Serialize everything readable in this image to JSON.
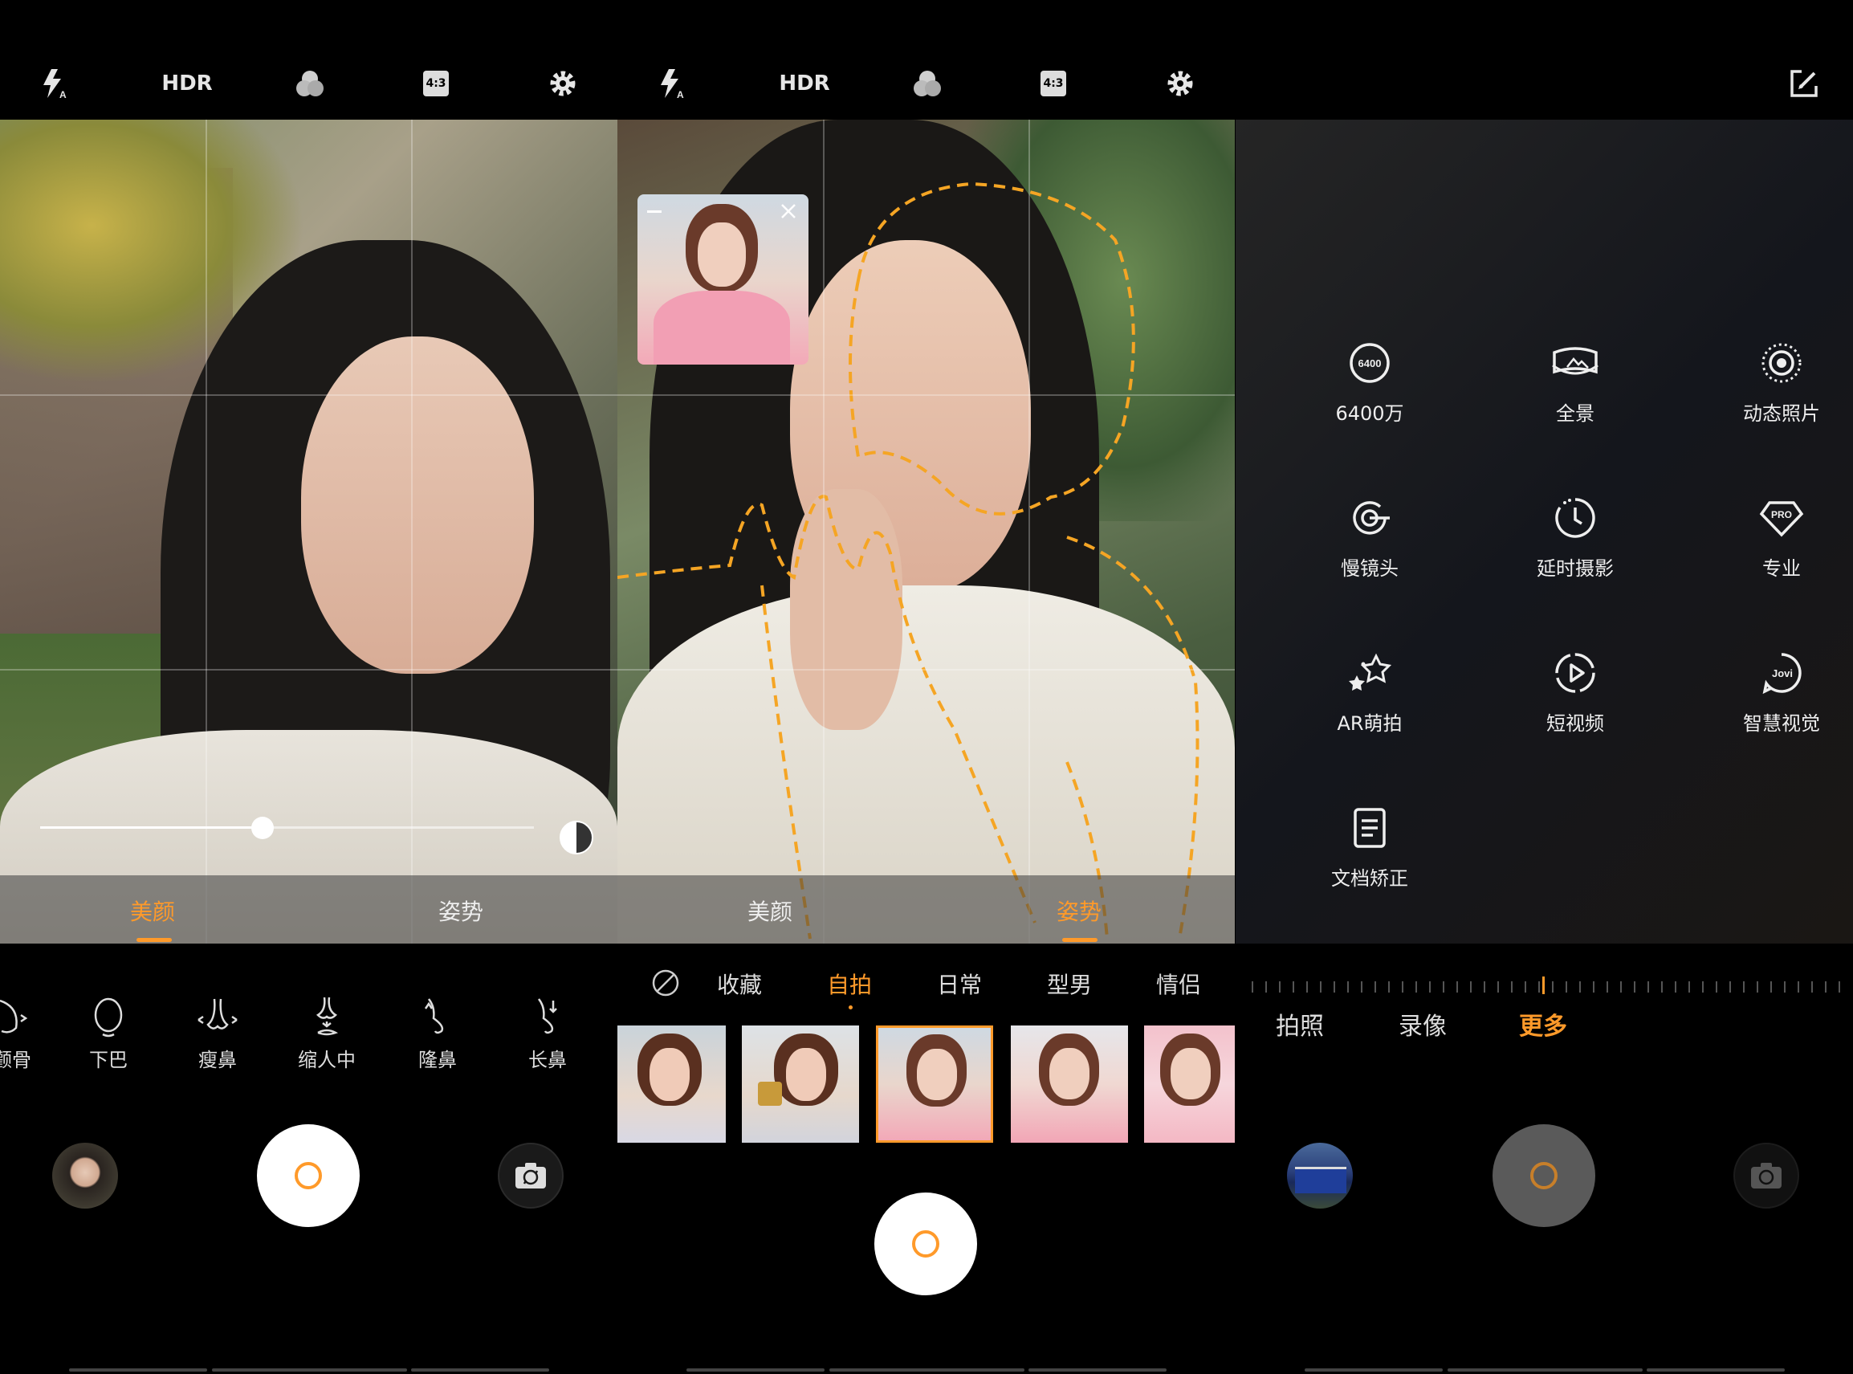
{
  "topbar": {
    "flash_icon": "flash-auto-icon",
    "hdr_label": "HDR",
    "filter_icon": "filter-icon",
    "ratio_label": "4:3",
    "settings_icon": "gear-icon"
  },
  "panel1": {
    "tabs": [
      {
        "label": "美颜"
      },
      {
        "label": "姿势"
      }
    ],
    "active_tab": "美颜",
    "slider_level": 0.45,
    "beauty_items": [
      {
        "label": "颧骨"
      },
      {
        "label": "下巴"
      },
      {
        "label": "瘦鼻"
      },
      {
        "label": "缩人中"
      },
      {
        "label": "隆鼻"
      },
      {
        "label": "长鼻"
      }
    ]
  },
  "panel2": {
    "tabs": [
      {
        "label": "美颜"
      },
      {
        "label": "姿势"
      }
    ],
    "active_tab": "姿势",
    "categories": [
      {
        "label": "收藏"
      },
      {
        "label": "自拍"
      },
      {
        "label": "日常"
      },
      {
        "label": "型男"
      },
      {
        "label": "情侣"
      }
    ],
    "active_category": "自拍",
    "selected_thumb_index": 2
  },
  "panel3": {
    "modes": [
      {
        "label": "6400万",
        "icon": "6400-icon",
        "badge": "6400"
      },
      {
        "label": "全景",
        "icon": "panorama-icon"
      },
      {
        "label": "动态照片",
        "icon": "live-photo-icon"
      },
      {
        "label": "慢镜头",
        "icon": "slow-motion-icon"
      },
      {
        "label": "延时摄影",
        "icon": "timelapse-icon"
      },
      {
        "label": "专业",
        "icon": "pro-icon",
        "badge": "PRO"
      },
      {
        "label": "AR萌拍",
        "icon": "ar-stars-icon"
      },
      {
        "label": "短视频",
        "icon": "short-video-icon"
      },
      {
        "label": "智慧视觉",
        "icon": "jovi-icon",
        "badge": "Jovi"
      },
      {
        "label": "文档矫正",
        "icon": "document-icon"
      }
    ],
    "bottom_modes": [
      {
        "label": "拍照"
      },
      {
        "label": "录像"
      },
      {
        "label": "更多"
      }
    ],
    "active_bottom_mode": "更多"
  },
  "colors": {
    "accent": "#ff9a2a",
    "background": "#000000"
  }
}
